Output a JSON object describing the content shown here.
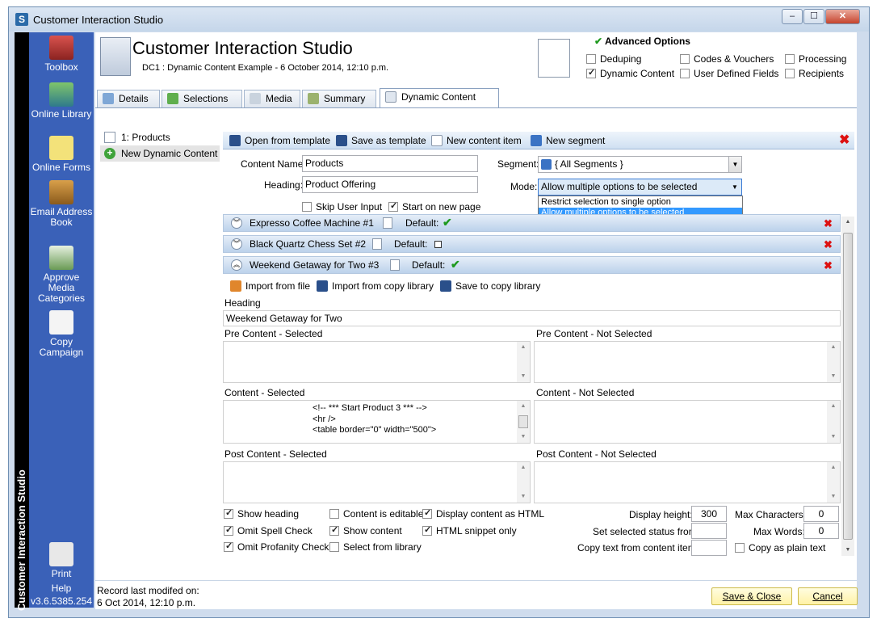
{
  "window": {
    "title": "Customer Interaction Studio",
    "app_icon_letter": "S"
  },
  "sidebar": {
    "strip_title": "Customer Interaction Studio",
    "items": [
      {
        "label": "Toolbox",
        "icon": "toolbox-icon"
      },
      {
        "label": "Online Library",
        "icon": "online-library-icon"
      },
      {
        "label": "Online Forms",
        "icon": "online-forms-icon"
      },
      {
        "label": "Email Address Book",
        "icon": "address-book-icon"
      },
      {
        "label": "Approve Media Categories",
        "icon": "approve-media-icon"
      },
      {
        "label": "Copy Campaign",
        "icon": "copy-campaign-icon"
      },
      {
        "label": "Print",
        "icon": "print-icon"
      },
      {
        "label": "Help",
        "icon": "help-icon"
      }
    ],
    "version": "v3.6.5385.254"
  },
  "header": {
    "title": "Customer Interaction Studio",
    "subtitle": "DC1 : Dynamic Content Example - 6 October 2014, 12:10 p.m."
  },
  "advanced": {
    "title": "Advanced Options",
    "options": [
      {
        "label": "Deduping",
        "checked": false
      },
      {
        "label": "Codes & Vouchers",
        "checked": false
      },
      {
        "label": "Processing",
        "checked": false
      },
      {
        "label": "Dynamic Content",
        "checked": true
      },
      {
        "label": "User Defined Fields",
        "checked": false
      },
      {
        "label": "Recipients",
        "checked": false
      }
    ]
  },
  "tabs": [
    {
      "label": "Details"
    },
    {
      "label": "Selections"
    },
    {
      "label": "Media"
    },
    {
      "label": "Summary"
    },
    {
      "label": "Dynamic Content",
      "active": true
    }
  ],
  "tree": {
    "items": [
      {
        "label": "1: Products"
      },
      {
        "label": "New Dynamic Content"
      }
    ]
  },
  "toolbar": {
    "open_template": "Open from template",
    "save_template": "Save as template",
    "new_content_item": "New content item",
    "new_segment": "New segment"
  },
  "form": {
    "content_name_label": "Content Name:",
    "content_name_value": "Products",
    "heading_label": "Heading:",
    "heading_value": "Product Offering",
    "segment_label": "Segment:",
    "segment_value": "{ All Segments }",
    "mode_label": "Mode:",
    "mode_value": "Allow multiple options to be selected",
    "mode_options": [
      "Restrict selection to single option",
      "Allow multiple options to be selected"
    ],
    "skip_user_input": "Skip User Input",
    "start_on_new_page": "Start on new page"
  },
  "content_items": [
    {
      "name": "Expresso Coffee Machine #1",
      "default_label": "Default:",
      "default": true
    },
    {
      "name": "Black Quartz Chess Set #2",
      "default_label": "Default:",
      "default": false
    },
    {
      "name": "Weekend Getaway for Two #3",
      "default_label": "Default:",
      "default": true
    }
  ],
  "item_toolbar": {
    "import_file": "Import from file",
    "import_copy": "Import from copy library",
    "save_copy": "Save to copy library"
  },
  "editor": {
    "heading_label": "Heading",
    "heading_value": "Weekend Getaway for Two",
    "pre_selected": "Pre Content - Selected",
    "pre_not_selected": "Pre Content - Not Selected",
    "content_selected": "Content - Selected",
    "content_not_selected": "Content - Not Selected",
    "post_selected": "Post Content - Selected",
    "post_not_selected": "Post Content - Not Selected",
    "content_code": [
      "<!-- *** Start Product 3 *** -->",
      "<hr />",
      "<table border=\"0\" width=\"500\">"
    ]
  },
  "options_bottom": {
    "show_heading": "Show heading",
    "omit_spell": "Omit Spell Check",
    "omit_profanity": "Omit Profanity Check",
    "content_editable": "Content is editable",
    "show_content": "Show content",
    "select_library": "Select from library",
    "display_html": "Display content as HTML",
    "html_snippet": "HTML snippet only",
    "display_height_label": "Display height:",
    "display_height_value": "300",
    "set_selected_status": "Set selected status from",
    "copy_text_from": "Copy text from content item:",
    "max_chars_label": "Max Characters:",
    "max_chars_value": "0",
    "max_words_label": "Max Words:",
    "max_words_value": "0",
    "copy_plain": "Copy as plain text"
  },
  "status": {
    "record_label": "Record last modifed on:",
    "record_value": "6 Oct 2014, 12:10 p.m."
  },
  "buttons": {
    "save_close": "Save & Close",
    "cancel": "Cancel"
  }
}
